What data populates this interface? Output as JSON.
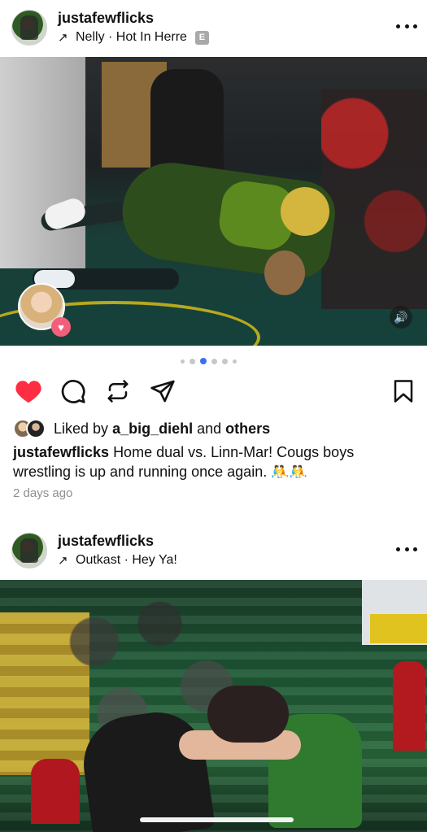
{
  "posts": [
    {
      "username": "justafewflicks",
      "music": "Nelly · Hot In Herre",
      "explicit_badge": "E",
      "carousel": {
        "count": 5,
        "active_index": 2
      },
      "liked_by_prefix": "Liked by",
      "liked_by_user": "a_big_diehl",
      "liked_by_and": "and",
      "liked_by_others": "others",
      "caption_user": "justafewflicks",
      "caption_text": "Home dual vs. Linn-Mar! Cougs boys wrestling is up and running once again. 🤼🤼",
      "time": "2 days ago",
      "liked": true
    },
    {
      "username": "justafewflicks",
      "music": "Outkast · Hey Ya!"
    }
  ],
  "icons": {
    "like": "heart-icon",
    "comment": "comment-icon",
    "repost": "repost-icon",
    "share": "send-icon",
    "save": "bookmark-icon",
    "more": "more-icon",
    "music": "arrow-icon",
    "sound": "speaker-icon"
  },
  "colors": {
    "like_red": "#ff2d41",
    "active_dot": "#3b6ef5",
    "muted_text": "#8e8e8e"
  }
}
